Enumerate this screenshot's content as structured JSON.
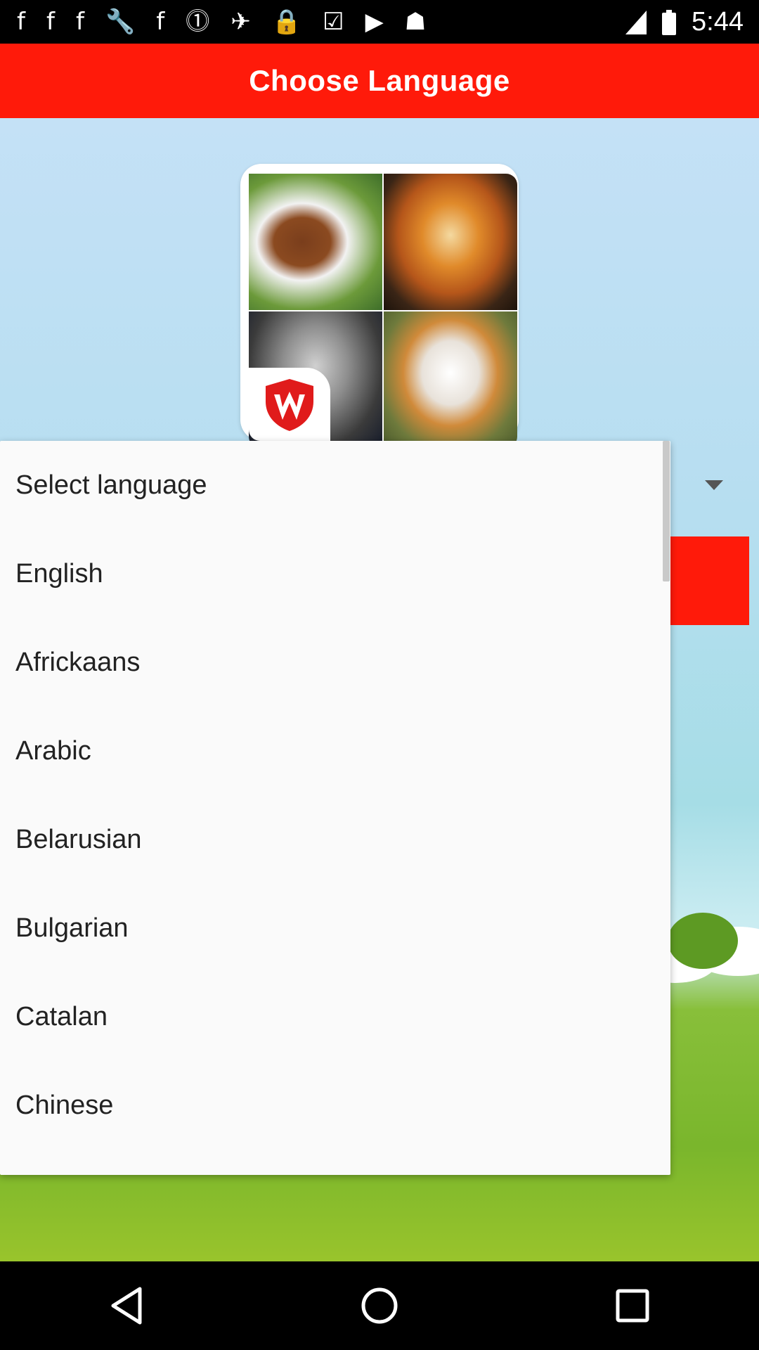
{
  "status_bar": {
    "time": "5:44",
    "icons": [
      "facebook-icon",
      "facebook-icon",
      "facebook-icon",
      "wrench-icon",
      "facebook-icon",
      "pinterest-icon",
      "fake-gps-icon",
      "lock-icon",
      "inbox-check-icon",
      "youtube-icon",
      "android-icon",
      "signal-icon",
      "battery-icon"
    ]
  },
  "header": {
    "title": "Choose Language"
  },
  "spinner": {
    "selected": "Select language"
  },
  "dropdown": {
    "items": [
      "Select language",
      "English",
      "Africkaans",
      "Arabic",
      "Belarusian",
      "Bulgarian",
      "Catalan",
      "Chinese"
    ]
  },
  "colors": {
    "accent": "#ff1a0a",
    "sky": "#c4e1f6",
    "grass": "#7ab62c"
  }
}
